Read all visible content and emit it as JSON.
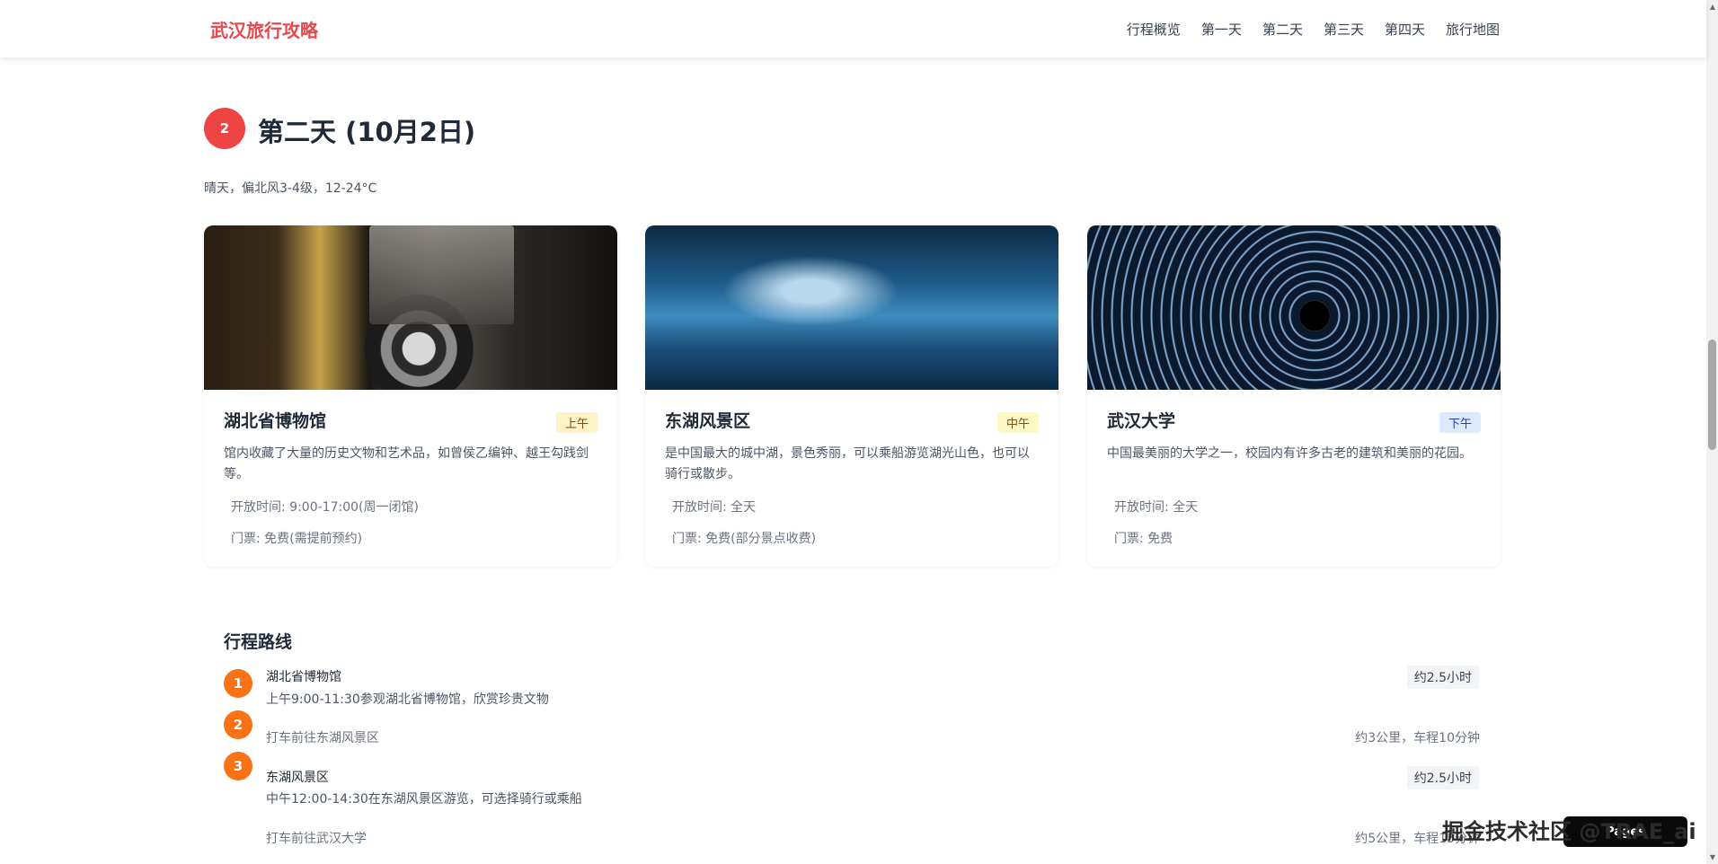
{
  "header": {
    "brand": "武汉旅行攻略",
    "nav": [
      "行程概览",
      "第一天",
      "第二天",
      "第三天",
      "第四天",
      "旅行地图"
    ]
  },
  "section": {
    "day_number": "2",
    "title": "第二天 (10月2日)",
    "weather": "晴天，偏北风3-4级，12-24°C"
  },
  "cards": [
    {
      "name": "湖北省博物馆",
      "tag": "上午",
      "image": "camera-photo",
      "desc": "馆内收藏了大量的历史文物和艺术品，如曾侯乙编钟、越王勾践剑等。",
      "hours": "开放时间: 9:00-17:00(周一闭馆)",
      "ticket": "门票: 免费(需提前预约)"
    },
    {
      "name": "东湖风景区",
      "tag": "中午",
      "image": "ocean-wave-photo",
      "desc": "是中国最大的城中湖，景色秀丽，可以乘船游览湖光山色，也可以骑行或散步。",
      "hours": "开放时间: 全天",
      "ticket": "门票: 免费(部分景点收费)"
    },
    {
      "name": "武汉大学",
      "tag": "下午",
      "image": "star-trail-photo",
      "desc": "中国最美丽的大学之一，校园内有许多古老的建筑和美丽的花园。",
      "hours": "开放时间: 全天",
      "ticket": "门票: 免费"
    }
  ],
  "route": {
    "title": "行程路线",
    "steps": [
      {
        "num": "1",
        "name": "湖北省博物馆",
        "desc": "上午9:00-11:30参观湖北省博物馆，欣赏珍贵文物",
        "duration": "约2.5小时"
      },
      {
        "num": "2",
        "transfer": "打车前往东湖风景区",
        "distance": "约3公里，车程10分钟"
      },
      {
        "num": "3",
        "name": "东湖风景区",
        "desc": "中午12:00-14:30在东湖风景区游览，可选择骑行或乘船",
        "duration": "约2.5小时"
      },
      {
        "transfer": "打车前往武汉大学",
        "distance": "约5公里，车程15分钟"
      }
    ]
  },
  "watermark": {
    "text": "掘金技术社区 @TRAE_ai",
    "badge": "Pages"
  }
}
